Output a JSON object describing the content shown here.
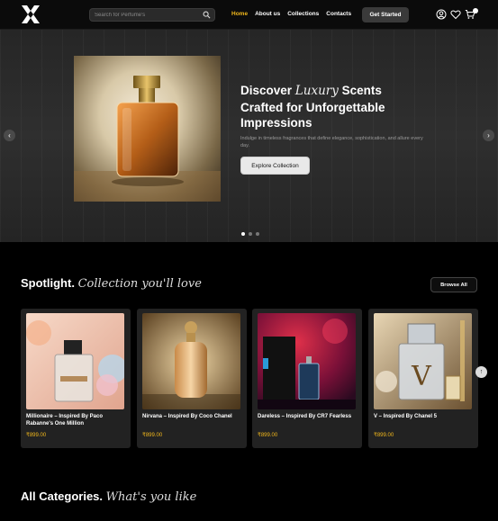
{
  "nav": {
    "search_placeholder": "Search for Perfume's",
    "links": [
      "Home",
      "About us",
      "Collections",
      "Contacts"
    ],
    "cta_label": "Get Started",
    "colors": {
      "active": "#f2b81c",
      "background": "#0b0b0b"
    },
    "icons": [
      "logo-x-icon",
      "search-icon",
      "user-icon",
      "heart-icon",
      "cart-icon"
    ]
  },
  "hero": {
    "title_line1_pre": "Discover ",
    "title_line1_em": "Luxury",
    "title_line1_post": " Scents",
    "title_line2": "Crafted for Unforgettable",
    "title_line3": "Impressions",
    "subtitle": "Indulge in timeless fragrances that define elegance, sophistication, and allure every day.",
    "button_label": "Explore Collection",
    "prev_icon": "‹",
    "next_icon": "›",
    "slide_count": 3,
    "active_slide": 1
  },
  "spotlight": {
    "title": "Spotlight.",
    "title_em": "Collection you'll love",
    "browse_label": "Browse All",
    "products": [
      {
        "name": "Millionaire – Inspired By Paco Rabanne's One Million",
        "price": "₹899.00"
      },
      {
        "name": "Nirvana – Inspired By Coco Chanel",
        "price": "₹899.00"
      },
      {
        "name": "Dareless – Inspired By CR7 Fearless",
        "price": "₹899.00"
      },
      {
        "name": "V – Inspired By Chanel 5",
        "price": "₹899.00"
      }
    ],
    "scroll_icon": "↑"
  },
  "categories": {
    "title": "All Categories.",
    "title_em": "What's you like"
  }
}
